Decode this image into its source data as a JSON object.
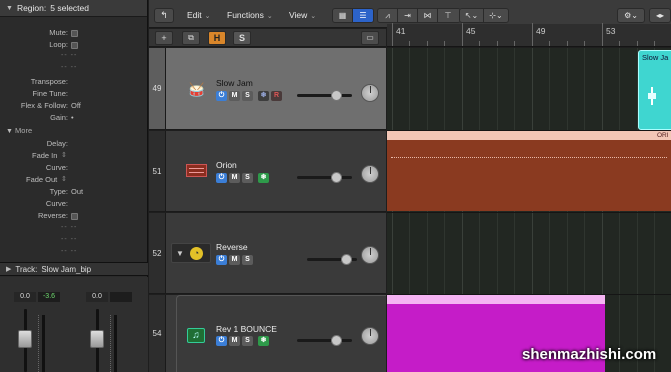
{
  "inspector": {
    "region_header": "Region:",
    "region_count": "5 selected",
    "params": {
      "mute": "Mute:",
      "loop": "Loop:",
      "transpose": "Transpose:",
      "fine_tune": "Fine Tune:",
      "flex_follow": "Flex & Follow:",
      "flex_value": "Off",
      "gain": "Gain:",
      "gain_value": "•",
      "more": "More",
      "delay": "Delay:",
      "fade_in": "Fade In",
      "curve": "Curve:",
      "fade_out": "Fade Out",
      "type": "Type:",
      "type_value": "Out",
      "curve2": "Curve:",
      "reverse": "Reverse:",
      "dashes": "-- --"
    },
    "track_label": "Track:",
    "track_name": "Slow Jam_bip",
    "strip": {
      "left_vol": "0.0",
      "left_peak": "-3.6",
      "right_vol": "0.0"
    }
  },
  "toolbar": {
    "back_icon": "arrow-up-left-icon",
    "edit": "Edit",
    "functions": "Functions",
    "view": "View"
  },
  "header_row": {
    "add": "+",
    "h": "H",
    "s": "S"
  },
  "ruler": {
    "bars": [
      "41",
      "45",
      "49",
      "53"
    ]
  },
  "tracks": [
    {
      "num": "49",
      "name": "Slow Jam",
      "icon": "drum-kit-icon"
    },
    {
      "num": "51",
      "name": "Orion",
      "icon": "keyboard-icon"
    },
    {
      "num": "52",
      "name": "Reverse",
      "icon": "clock-icon"
    },
    {
      "num": "54",
      "name": "Rev 1 BOUNCE",
      "icon": "music-note-icon"
    }
  ],
  "track_buttons": {
    "m": "M",
    "s": "S",
    "r": "R"
  },
  "regions": {
    "slow_jam": "Slow Ja",
    "orion": "ORI"
  },
  "watermark": "shenmazhishi.com",
  "colors": {
    "accent_blue": "#2c63c9",
    "orange": "#d9862a",
    "region_cyan": "#3fd6d0",
    "region_orion_top": "#f2c6b6",
    "region_orion": "#8a3a20",
    "region_magenta": "#c51cc8",
    "region_magenta_top": "#f5b4f3"
  }
}
